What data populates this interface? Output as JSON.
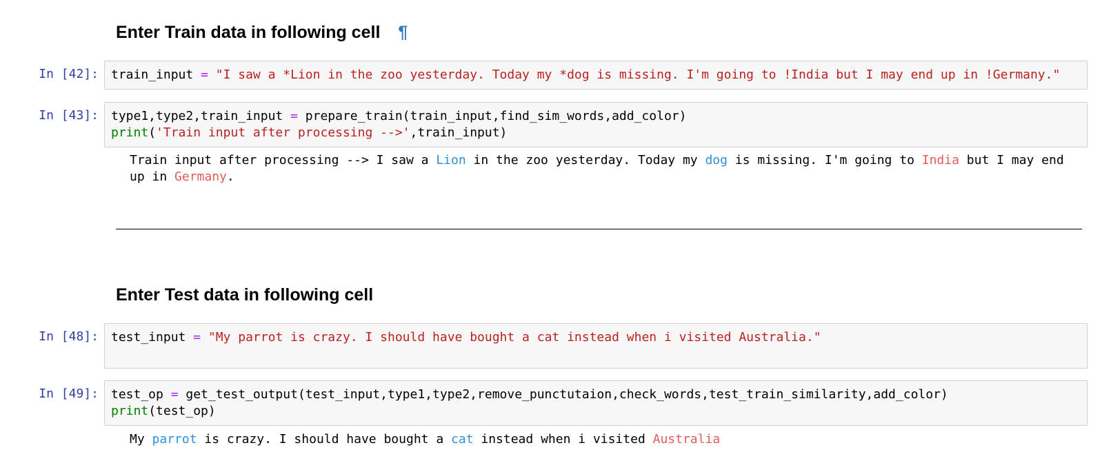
{
  "sections": {
    "train_heading": "Enter Train data in following cell",
    "anchor_symbol": "¶",
    "test_heading": "Enter Test data in following cell"
  },
  "cells": [
    {
      "prompt": "In [42]:",
      "lines": [
        [
          {
            "t": "train_input ",
            "c": "plain"
          },
          {
            "t": "=",
            "c": "op"
          },
          {
            "t": " ",
            "c": "plain"
          },
          {
            "t": "\"I saw a *Lion in the zoo yesterday. Today my *dog is missing. I'm going to !India but I may end up in !Germany.\"",
            "c": "str"
          }
        ]
      ]
    },
    {
      "prompt": "In [43]:",
      "lines": [
        [
          {
            "t": "type1,type2,train_input ",
            "c": "plain"
          },
          {
            "t": "=",
            "c": "op"
          },
          {
            "t": " prepare_train(train_input,find_sim_words,add_color)",
            "c": "plain"
          }
        ],
        [
          {
            "t": "print",
            "c": "kw"
          },
          {
            "t": "(",
            "c": "plain"
          },
          {
            "t": "'Train input after processing -->'",
            "c": "str"
          },
          {
            "t": ",train_input)",
            "c": "plain"
          }
        ]
      ],
      "output": [
        {
          "t": "Train input after processing --> I saw a ",
          "c": "plain"
        },
        {
          "t": "Lion",
          "c": "w-blue"
        },
        {
          "t": " in the zoo yesterday. Today my ",
          "c": "plain"
        },
        {
          "t": "dog",
          "c": "w-blue"
        },
        {
          "t": " is missing. I'm going to ",
          "c": "plain"
        },
        {
          "t": "India",
          "c": "w-red"
        },
        {
          "t": " but I may end up in ",
          "c": "plain"
        },
        {
          "t": "Germany",
          "c": "w-red"
        },
        {
          "t": ".",
          "c": "plain"
        }
      ]
    },
    {
      "prompt": "In [48]:",
      "lines": [
        [
          {
            "t": "test_input ",
            "c": "plain"
          },
          {
            "t": "=",
            "c": "op"
          },
          {
            "t": " ",
            "c": "plain"
          },
          {
            "t": "\"My parrot is crazy. I should have bought a cat instead when i visited Australia.\"",
            "c": "str"
          }
        ],
        [
          {
            "t": "",
            "c": "plain"
          }
        ]
      ]
    },
    {
      "prompt": "In [49]:",
      "lines": [
        [
          {
            "t": "test_op ",
            "c": "plain"
          },
          {
            "t": "=",
            "c": "op"
          },
          {
            "t": " get_test_output(test_input,type1,type2,remove_punctutaion,check_words,test_train_similarity,add_color)",
            "c": "plain"
          }
        ],
        [
          {
            "t": "print",
            "c": "kw"
          },
          {
            "t": "(test_op)",
            "c": "plain"
          }
        ]
      ],
      "output": [
        {
          "t": "My ",
          "c": "plain"
        },
        {
          "t": "parrot",
          "c": "w-blue"
        },
        {
          "t": " is crazy. I should have bought a ",
          "c": "plain"
        },
        {
          "t": "cat",
          "c": "w-blue"
        },
        {
          "t": " instead when i visited ",
          "c": "plain"
        },
        {
          "t": "Australia",
          "c": "w-red"
        }
      ]
    }
  ],
  "colors": {
    "prompt": "#303f9f",
    "string": "#ba2121",
    "operator": "#aa22ff",
    "keyword": "#008000",
    "highlight_blue": "#2f8fdb",
    "highlight_red": "#e25c5c",
    "anchor": "#337ab7"
  }
}
